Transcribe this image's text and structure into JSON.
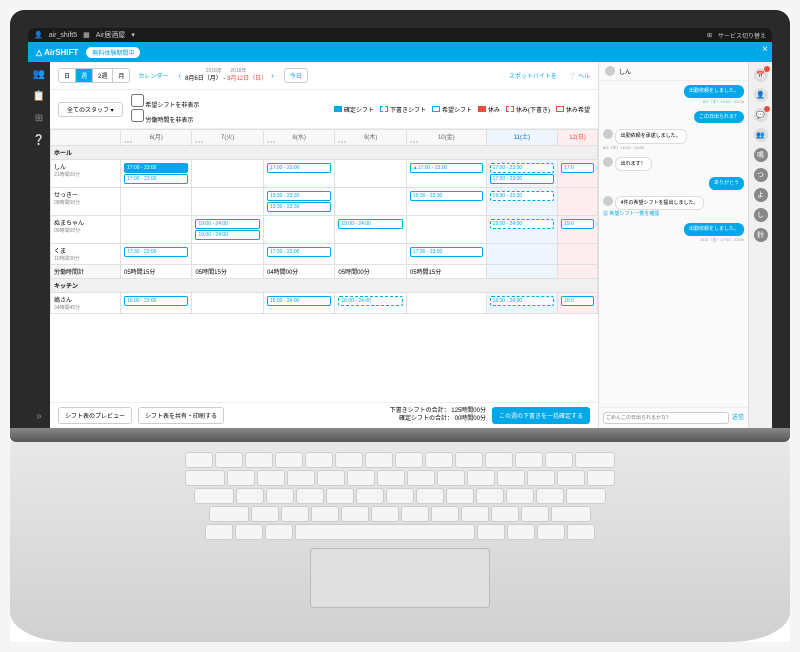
{
  "os": {
    "user": "air_shift5",
    "store": "Air居酒屋",
    "switch": "サービス切り替え"
  },
  "app": {
    "name": "AirSHIFT",
    "badge": "無料体験期間中"
  },
  "toolbar": {
    "views": [
      "日",
      "週",
      "2週",
      "月"
    ],
    "active_view": 1,
    "calendar": "カレンダー",
    "year": "2018年",
    "date_from": "8月6日（月）",
    "date_to": "8月12日（日）",
    "today": "今日",
    "spot": "スポットバイトを",
    "help": "ヘル"
  },
  "filter": {
    "staff_all": "全てのスタッフ",
    "chk1": "希望シフトを非表示",
    "chk2": "労働時間を非表示",
    "lg1": "確定シフト",
    "lg2": "下書きシフト",
    "lg3": "希望シフト",
    "lg4": "休み",
    "lg5": "休み(下書き)",
    "lg6": "休み希望"
  },
  "days": [
    "6(月)",
    "7(火)",
    "8(水)",
    "9(木)",
    "10(金)",
    "11(土)",
    "12(日)"
  ],
  "sections": {
    "hall": "ホール",
    "kitchen": "キッチン"
  },
  "staff": [
    {
      "name": "しん",
      "hours": "21時間00分",
      "shifts": [
        [
          "17:00 - 23:00 filled",
          "17:00 - 23:00"
        ],
        [
          ""
        ],
        [
          "17:00 - 23:00"
        ],
        [
          ""
        ],
        [
          "▲17:00 - 23:00"
        ],
        [
          "17:00 - 23:00 draft",
          "17:00 - 23:00"
        ],
        [
          "17:0"
        ]
      ]
    },
    {
      "name": "せっきー",
      "hours": "08時間00分",
      "shifts": [
        [
          ""
        ],
        [
          ""
        ],
        [
          "19:30 - 23:30",
          "19:30 - 23:30"
        ],
        [
          ""
        ],
        [
          "19:30 - 23:30"
        ],
        [
          "19:30 - 23:30 draft"
        ],
        [
          ""
        ]
      ]
    },
    {
      "name": "ぬまちゃん",
      "hours": "00時間00分",
      "shifts": [
        [
          ""
        ],
        [
          "19:00 - 24:00",
          "19:00 - 24:00"
        ],
        [
          ""
        ],
        [
          "19:00 - 24:00"
        ],
        [
          ""
        ],
        [
          "19:00 - 24:00 draft"
        ],
        [
          "19:0"
        ]
      ]
    },
    {
      "name": "くま",
      "hours": "11時間30分",
      "shifts": [
        [
          "17:30 - 23:00"
        ],
        [
          ""
        ],
        [
          "17:30 - 23:00"
        ],
        [
          ""
        ],
        [
          "17:30 - 23:00"
        ],
        [
          ""
        ],
        [
          ""
        ]
      ]
    }
  ],
  "work_hours": {
    "label": "労働時間計",
    "vals": [
      "05時間15分",
      "05時間15分",
      "04時間00分",
      "05時間00分",
      "05時間15分",
      "",
      ""
    ]
  },
  "kitchen_staff": [
    {
      "name": "嶋さん",
      "hours": "34時間45分",
      "shifts": [
        [
          "16:00 - 23:00"
        ],
        [
          ""
        ],
        [
          "16:00 - 24:00"
        ],
        [
          "16:00 - 24:00 draft"
        ],
        [
          ""
        ],
        [
          "16:00 - 24:00 draft"
        ],
        [
          "16:0"
        ]
      ]
    }
  ],
  "footer": {
    "preview": "シフト表のプレビュー",
    "share": "シフト表を共有・印刷する",
    "draft_total_label": "下書きシフトの合計：",
    "draft_total": "125時間00分",
    "fixed_total_label": "確定シフトの合計：",
    "fixed_total": "00時間00分",
    "confirm": "この週の下書きを一括確定する"
  },
  "chat": {
    "name": "しん",
    "msgs": [
      {
        "dir": "out",
        "text": "出勤依頼をしました。",
        "meta": "8/2（木）16:00 - 23:00"
      },
      {
        "dir": "out",
        "text": "この日出られる？"
      },
      {
        "dir": "in",
        "text": "出勤依頼を承諾しました。",
        "meta": "8/2（木）16:00 - 16:04"
      },
      {
        "dir": "in",
        "text": "出れます！"
      },
      {
        "dir": "out",
        "text": "ありがとう"
      },
      {
        "dir": "in",
        "text": "4件の希望シフトを提出しました。",
        "link": "希望シフト一覧を確認"
      },
      {
        "dir": "out",
        "text": "出勤依頼をしました。",
        "meta": "8/10（金）17:00 - 23:00"
      }
    ],
    "input_placeholder": "ごめんこの日出られるかな？",
    "send": "送信"
  },
  "rside": [
    "鳴",
    "つ",
    "よ",
    "し",
    "鈴"
  ]
}
